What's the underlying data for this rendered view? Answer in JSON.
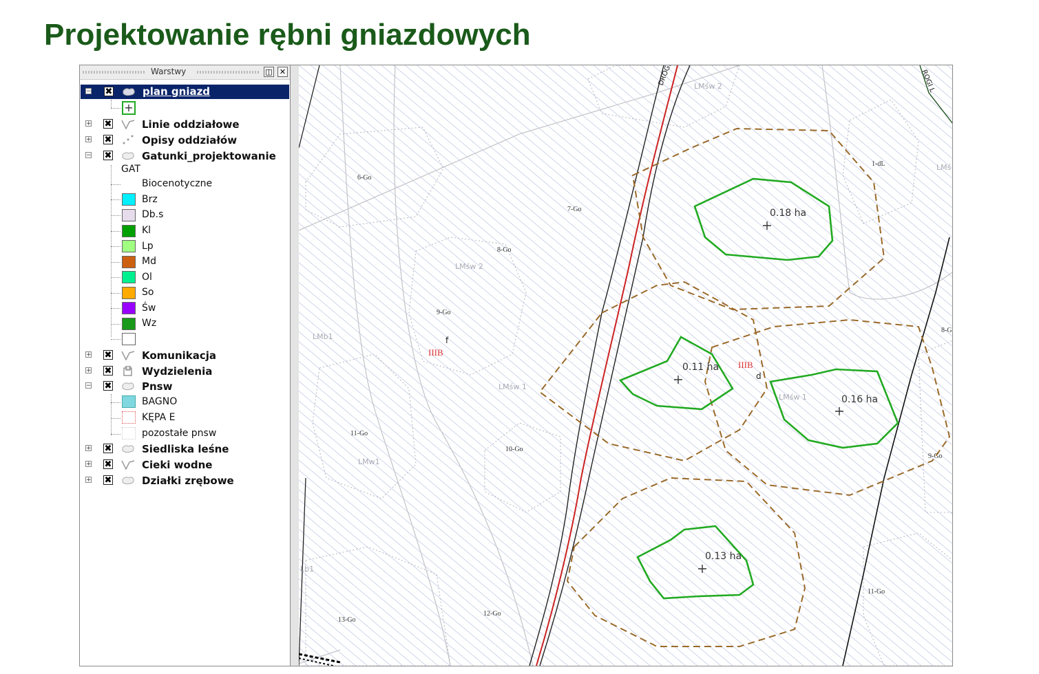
{
  "title": "Projektowanie rębni gniazdowych",
  "layers_panel": {
    "title": "Warstwy",
    "selected_layer": "plan gniazd",
    "layers": [
      {
        "label": "Linie oddziałowe"
      },
      {
        "label": "Opisy oddziałów"
      },
      {
        "label": "Gatunki_projektowanie"
      },
      {
        "label": "Komunikacja"
      },
      {
        "label": "Wydzielenia"
      },
      {
        "label": "Pnsw"
      },
      {
        "label": "Siedliska leśne"
      },
      {
        "label": "Cieki wodne"
      },
      {
        "label": "Działki zrębowe"
      }
    ],
    "gat_header": "GAT",
    "species_legend": [
      {
        "label": "Biocenotyczne",
        "color": "#ffffff"
      },
      {
        "label": "Brz",
        "color": "#00f0ff"
      },
      {
        "label": "Db.s",
        "color": "#e6dcec"
      },
      {
        "label": "Kl",
        "color": "#00a000"
      },
      {
        "label": "Lp",
        "color": "#a0ff80"
      },
      {
        "label": "Md",
        "color": "#cc6010"
      },
      {
        "label": "Ol",
        "color": "#00f090"
      },
      {
        "label": "So",
        "color": "#ffaa00"
      },
      {
        "label": "Św",
        "color": "#9900ff"
      },
      {
        "label": "Wz",
        "color": "#1a9a1a"
      }
    ],
    "pnsw_legend": [
      {
        "label": "BAGNO"
      },
      {
        "label": "KĘPA E"
      },
      {
        "label": "pozostałe pnsw"
      }
    ]
  },
  "map": {
    "area_labels": [
      "0.18 ha",
      "0.11 ha",
      "0.16 ha",
      "0.13 ha"
    ],
    "stand_labels": [
      "6-Go",
      "7-Go",
      "8-Go",
      "9-Go",
      "10-Go",
      "11-Go",
      "12-Go",
      "13-Go",
      "1-dL",
      "8-G",
      "9-Go",
      "11-Go"
    ],
    "habitat_labels": [
      "LMśw 2",
      "LMśw 2",
      "LMśw 1",
      "LMśw 1",
      "LMb1",
      "LMw1",
      "LMś",
      "Lb1"
    ],
    "site_labels": [
      "IIIB",
      "IIIB"
    ],
    "letter_labels": [
      "f",
      "d"
    ],
    "road_labels": [
      "DROGI",
      "ROGI L"
    ],
    "colors": {
      "gap_outline": "#22aa22",
      "buffer_outline": "#9a6a2a",
      "road": "#cc2222",
      "hatch": "#aab4d8",
      "title": "#1a5a1a"
    }
  }
}
